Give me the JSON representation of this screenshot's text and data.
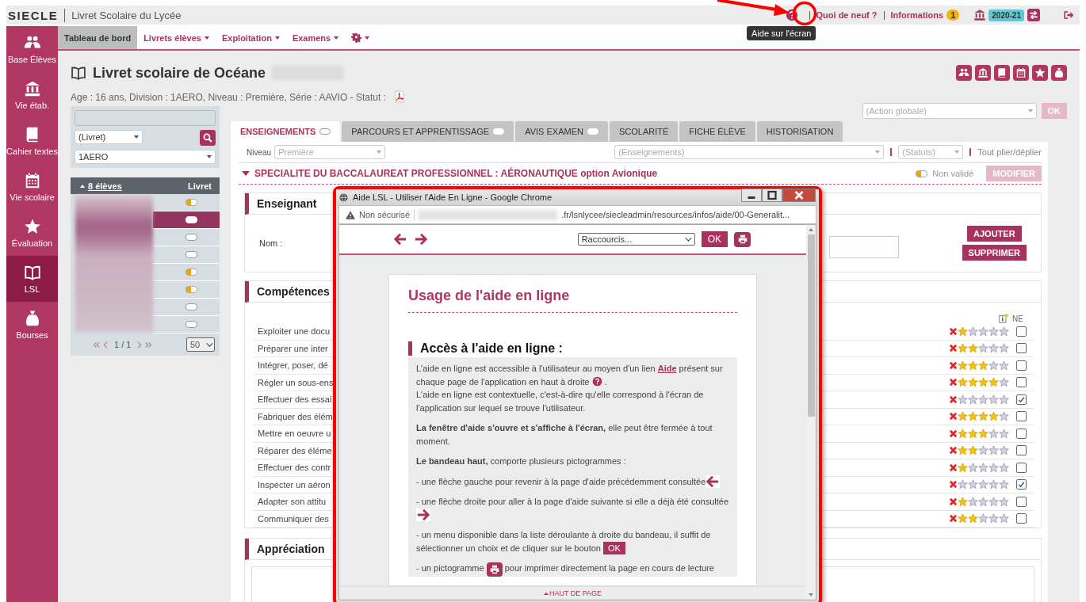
{
  "app": {
    "brand": "SIECLE",
    "title": "Livret Scolaire du Lycée"
  },
  "top_links": [
    {
      "label": "Quoi de neuf ?"
    },
    {
      "label": "Informations",
      "badge": "1"
    }
  ],
  "year": "2020-21",
  "tooltip": "Aide sur l'écran",
  "sidebar": {
    "items": [
      {
        "label": "Base Élèves",
        "kind": "people",
        "selected": false
      },
      {
        "label": "Vie étab.",
        "kind": "bank",
        "selected": false
      },
      {
        "label": "Cahier textes",
        "kind": "book",
        "selected": false
      },
      {
        "label": "Vie scolaire",
        "kind": "calendar",
        "selected": false
      },
      {
        "label": "Évaluation",
        "kind": "star",
        "selected": false
      },
      {
        "label": "LSL",
        "kind": "openbook",
        "selected": true
      },
      {
        "label": "Bourses",
        "kind": "bag",
        "selected": false
      }
    ]
  },
  "menu": [
    {
      "kind": "text",
      "label": "Tableau de bord",
      "selected": true,
      "dropdown": false
    },
    {
      "kind": "text",
      "label": "Livrets élèves",
      "selected": false,
      "dropdown": true
    },
    {
      "kind": "text",
      "label": "Exploitation",
      "selected": false,
      "dropdown": true
    },
    {
      "kind": "text",
      "label": "Examens",
      "selected": false,
      "dropdown": true
    },
    {
      "kind": "gear",
      "selected": false,
      "dropdown": true
    }
  ],
  "page": {
    "title": "Livret scolaire de Océane",
    "info": "Age : 16 ans, Division : 1AERO, Niveau : Première, Série : AAVIO - Statut :"
  },
  "action": {
    "placeholder": "(Action globale)",
    "button": "OK",
    "disabled": true
  },
  "filters": {
    "livret": "(Livret)",
    "division": "1AERO"
  },
  "students": {
    "count": "8 élèves",
    "column": "Livret",
    "rows": [
      {
        "partial": true,
        "selected": false
      },
      {
        "partial": false,
        "selected": true
      },
      {
        "partial": false,
        "selected": false
      },
      {
        "partial": false,
        "selected": false
      },
      {
        "partial": true,
        "selected": false
      },
      {
        "partial": true,
        "selected": false
      },
      {
        "partial": false,
        "selected": false
      },
      {
        "partial": false,
        "selected": false
      }
    ],
    "pager": "1 / 1",
    "page_size": "50"
  },
  "tabs": [
    {
      "label": "ENSEIGNEMENTS",
      "toggle": true,
      "selected": true
    },
    {
      "label": "PARCOURS ET APPRENTISSAGE",
      "toggle": true,
      "selected": false
    },
    {
      "label": "AVIS EXAMEN",
      "toggle": true,
      "selected": false
    },
    {
      "label": "SCOLARITÉ",
      "toggle": false,
      "selected": false
    },
    {
      "label": "FICHE ÉLÈVE",
      "toggle": false,
      "selected": false
    },
    {
      "label": "HISTORISATION",
      "toggle": false,
      "selected": false
    }
  ],
  "subject_filters": {
    "niveau_label": "Niveau",
    "niveau": "Première",
    "enseignements": "(Enseignements)",
    "statuts": "(Statuts)",
    "fold": "Tout plier/déplier"
  },
  "specialite": {
    "title": "SPECIALITE DU BACCALAUREAT PROFESSIONNEL : AÉRONAUTIQUE option Avionique",
    "partial": true,
    "status_label": "Non validé",
    "button": "MODIFIER",
    "disabled": true
  },
  "enseignant": {
    "title": "Enseignant",
    "name_label": "Nom :",
    "buttons": [
      "AJOUTER",
      "SUPPRIMER"
    ]
  },
  "competences": {
    "title": "Compétences",
    "ne_label": "NE",
    "rows": [
      {
        "label": "Exploiter une docu",
        "stars": 1,
        "ne": false
      },
      {
        "label": "Préparer une inter",
        "stars": 2,
        "ne": false
      },
      {
        "label": "Intégrer, poser, dé",
        "stars": 3,
        "ne": false
      },
      {
        "label": "Régler un sous-ens",
        "stars": 4,
        "ne": false
      },
      {
        "label": "Effectuer des essai",
        "stars": 0,
        "ne": true
      },
      {
        "label": "Fabriquer des élém",
        "stars": 4,
        "ne": false
      },
      {
        "label": "Mettre en oeuvre u",
        "stars": 3,
        "ne": false
      },
      {
        "label": "Réparer des éléme",
        "stars": 2,
        "ne": false
      },
      {
        "label": "Effectuer des contr",
        "stars": 1,
        "ne": false
      },
      {
        "label": "Inspecter un aéron",
        "stars": 0,
        "ne": true
      },
      {
        "label": "Adapter son attitu",
        "stars": 1,
        "ne": false
      },
      {
        "label": "Communiquer des",
        "stars": 2,
        "ne": false
      }
    ]
  },
  "appreciation": {
    "title": "Appréciation"
  },
  "help_window": {
    "title": "Aide LSL - Utiliser l'Aide En Ligne - Google Chrome",
    "security": "Non sécurisé",
    "url": ".fr/lsnlycee/siecleadmin/resources/infos/aide/00-Generalit...",
    "shortcuts": "Raccourcis...",
    "ok": "OK",
    "heading": "Usage de l'aide en ligne",
    "section": "Accès à l'aide en ligne :",
    "paragraphs": [
      [
        {
          "kind": "text",
          "text": "L'aide en ligne est accessible à l'utilisateur au moyen d'un lien "
        },
        {
          "kind": "link",
          "text": "Aide"
        },
        {
          "kind": "text",
          "text": " présent sur chaque page de l'application en haut à droite "
        },
        {
          "kind": "help_icon"
        },
        {
          "kind": "text",
          "text": " ."
        },
        {
          "kind": "break"
        },
        {
          "kind": "text",
          "text": "L'aide en ligne est contextuelle, c'est-à-dire qu'elle correspond à l'écran de l'application sur lequel se trouve l'utilisateur."
        }
      ],
      [
        {
          "kind": "text",
          "text": "**La fenêtre d'aide s'ouvre et s'affiche à l'écran,** elle peut être fermée à tout moment."
        }
      ],
      [
        {
          "kind": "text",
          "text": "**Le bandeau haut,** comporte plusieurs pictogrammes :"
        }
      ],
      [
        {
          "kind": "text",
          "text": "- une flèche gauche pour revenir à la page d'aide précédemment consultée"
        },
        {
          "kind": "left_arrow"
        }
      ],
      [
        {
          "kind": "text",
          "text": "- une flèche droite pour aller à la page d'aide suivante si elle a déjà été consultée "
        },
        {
          "kind": "right_arrow"
        }
      ],
      [
        {
          "kind": "text",
          "text": "- un menu disponible dans la liste déroulante à droite du bandeau, il suffit de sélectionner un choix et de cliquer sur le bouton "
        },
        {
          "kind": "ok_button",
          "text": "OK"
        }
      ],
      [
        {
          "kind": "text",
          "text": "- un pictogramme "
        },
        {
          "kind": "print_icon"
        },
        {
          "kind": "text",
          "text": " pour imprimer directement la page en cours de lecture"
        }
      ]
    ],
    "footer": "HAUT DE PAGE"
  }
}
